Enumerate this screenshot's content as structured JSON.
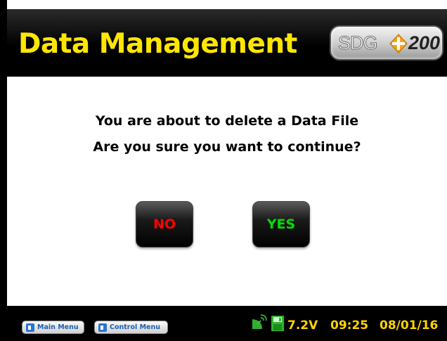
{
  "header": {
    "title": "Data Management",
    "logo_text_left": "SDG",
    "logo_text_right": "200"
  },
  "dialog": {
    "line1": "You are about to delete a Data File",
    "line2": "Are you sure you want to continue?",
    "no_label": "NO",
    "yes_label": "YES"
  },
  "footer": {
    "main_menu_label": "Main Menu",
    "control_menu_label": "Control Menu",
    "voltage": "7.2V",
    "time": "09:25",
    "date": "08/01/16"
  },
  "colors": {
    "title": "#ffe600",
    "no": "#ff0000",
    "yes": "#00e000",
    "status": "#ffd400",
    "nav_text": "#1f5fb0"
  },
  "icons": [
    "satellite-icon",
    "floppy-disk-icon",
    "exit-door-icon"
  ]
}
